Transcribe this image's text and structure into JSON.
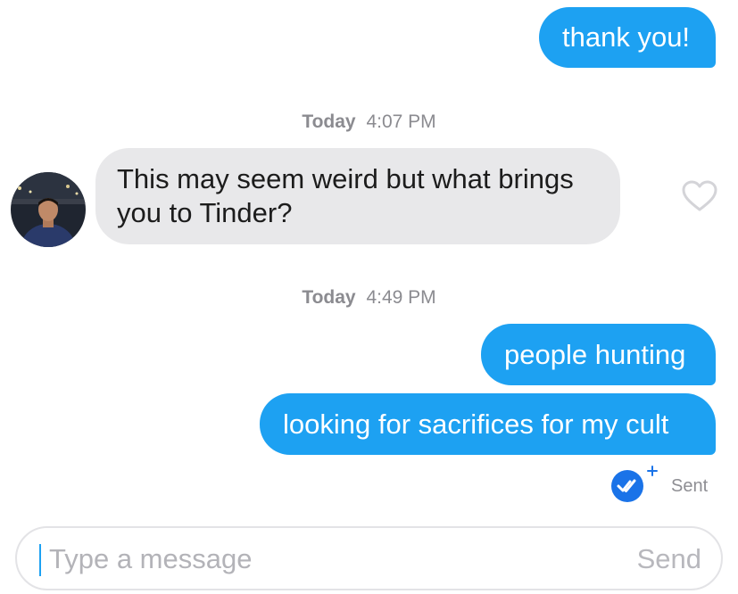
{
  "messages": [
    {
      "text": "thank you!"
    },
    {
      "timestamp_day": "Today",
      "timestamp_time": "4:07 PM"
    },
    {
      "text": "This may seem weird but what brings you to Tinder?"
    },
    {
      "timestamp_day": "Today",
      "timestamp_time": "4:49 PM"
    },
    {
      "text": "people hunting"
    },
    {
      "text": "looking for sacrifices for my cult"
    }
  ],
  "status": {
    "label": "Sent",
    "icon": "double-check-icon"
  },
  "composer": {
    "placeholder": "Type a message",
    "send_label": "Send"
  },
  "colors": {
    "outgoing_bubble": "#1da1f2",
    "incoming_bubble": "#e8e8ea",
    "timestamp": "#8b8b90",
    "read_receipt": "#1a73e8"
  }
}
